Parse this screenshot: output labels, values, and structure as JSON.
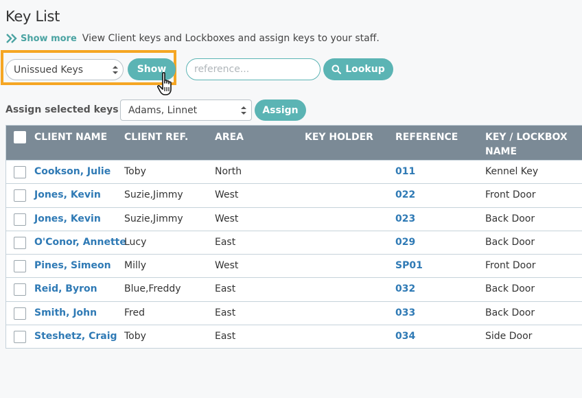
{
  "page": {
    "title": "Key List",
    "show_more": "Show more",
    "description": "View Client keys and Lockboxes and assign keys to your staff."
  },
  "filters": {
    "keys_select_value": "Unissued Keys",
    "show_label": "Show",
    "reference_placeholder": "reference...",
    "lookup_label": "Lookup"
  },
  "assign": {
    "label": "Assign selected keys to",
    "staff_value": "Adams, Linnet",
    "button_label": "Assign"
  },
  "table": {
    "headers": {
      "client_name": "CLIENT NAME",
      "client_ref": "CLIENT REF.",
      "area": "AREA",
      "key_holder": "KEY HOLDER",
      "reference": "REFERENCE",
      "key_lockbox_1": "KEY / LOCKBOX",
      "key_lockbox_2": "NAME"
    },
    "rows": [
      {
        "client_name": "Cookson, Julie",
        "client_ref": "Toby",
        "area": "North",
        "key_holder": "",
        "reference": "011",
        "key_name": "Kennel Key"
      },
      {
        "client_name": "Jones, Kevin",
        "client_ref": "Suzie,Jimmy",
        "area": "West",
        "key_holder": "",
        "reference": "022",
        "key_name": "Front Door"
      },
      {
        "client_name": "Jones, Kevin",
        "client_ref": "Suzie,Jimmy",
        "area": "West",
        "key_holder": "",
        "reference": "023",
        "key_name": "Back Door"
      },
      {
        "client_name": "O'Conor, Annette",
        "client_ref": "Lucy",
        "area": "East",
        "key_holder": "",
        "reference": "029",
        "key_name": "Back Door"
      },
      {
        "client_name": "Pines, Simeon",
        "client_ref": "Milly",
        "area": "West",
        "key_holder": "",
        "reference": "SP01",
        "key_name": "Front Door"
      },
      {
        "client_name": "Reid, Byron",
        "client_ref": "Blue,Freddy",
        "area": "East",
        "key_holder": "",
        "reference": "032",
        "key_name": "Back Door"
      },
      {
        "client_name": "Smith, John",
        "client_ref": "Fred",
        "area": "East",
        "key_holder": "",
        "reference": "033",
        "key_name": "Back Door"
      },
      {
        "client_name": "Steshetz, Craig",
        "client_ref": "Toby",
        "area": "East",
        "key_holder": "",
        "reference": "034",
        "key_name": "Side Door"
      }
    ]
  },
  "colors": {
    "accent": "#5bb4b4",
    "highlight": "#f5a623",
    "header_bg": "#7b8a96",
    "link": "#2f7ab5"
  }
}
